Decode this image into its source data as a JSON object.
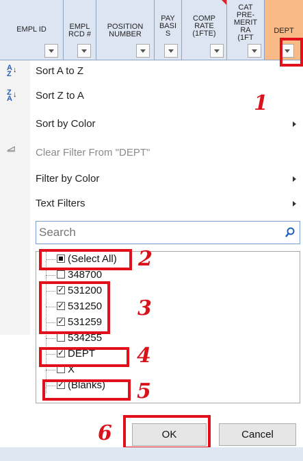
{
  "header": {
    "columns": [
      {
        "label": "EMPL ID"
      },
      {
        "label": "EMPL\nRCD #"
      },
      {
        "label": "POSITION\nNUMBER"
      },
      {
        "label": "PAY\nBASI\nS"
      },
      {
        "label": "COMP\nRATE\n(1FTE)"
      },
      {
        "label": "CAT\nPRE-\nMERIT\nRA\n(1FT"
      },
      {
        "label": "DEPT"
      }
    ]
  },
  "menu": {
    "sort_az": "Sort A to Z",
    "sort_za": "Sort Z to A",
    "sort_color": "Sort by Color",
    "clear_filter": "Clear Filter From \"DEPT\"",
    "filter_color": "Filter by Color",
    "text_filters": "Text Filters"
  },
  "search": {
    "placeholder": "Search"
  },
  "filter_list": {
    "items": [
      {
        "label": "(Select All)",
        "state": "partial"
      },
      {
        "label": "348700",
        "state": "unchecked"
      },
      {
        "label": "531200",
        "state": "checked"
      },
      {
        "label": "531250",
        "state": "checked"
      },
      {
        "label": "531259",
        "state": "checked"
      },
      {
        "label": "534255",
        "state": "unchecked"
      },
      {
        "label": "DEPT",
        "state": "checked"
      },
      {
        "label": "X",
        "state": "unchecked"
      },
      {
        "label": "(Blanks)",
        "state": "checked"
      }
    ]
  },
  "buttons": {
    "ok": "OK",
    "cancel": "Cancel"
  },
  "annotations": [
    "1",
    "2",
    "3",
    "4",
    "5",
    "6"
  ],
  "icons": {
    "sort_az": "sort-ascending-icon",
    "sort_za": "sort-descending-icon",
    "clear_filter": "clear-filter-icon",
    "search": "magnifier-icon"
  },
  "colors": {
    "highlight": "#e2101b",
    "header_bg": "#dde5f2",
    "selected_header_bg": "#f8ba86"
  }
}
